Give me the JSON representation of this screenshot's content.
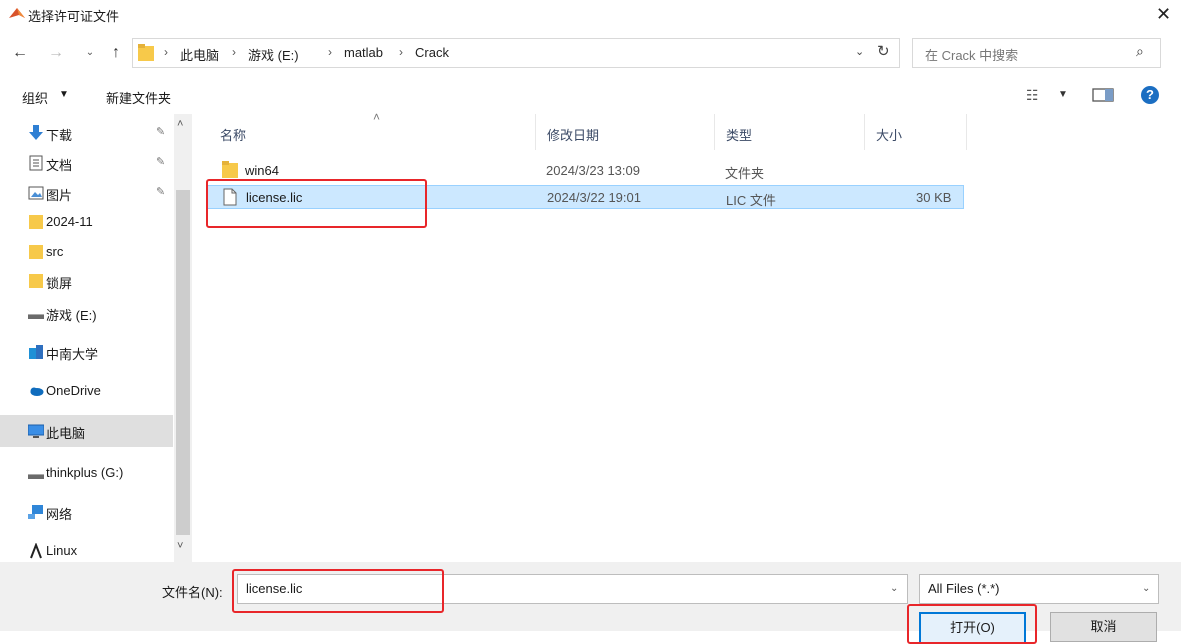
{
  "window": {
    "title": "选择许可证文件",
    "close_glyph": "✕",
    "app_icon": "matlab-icon"
  },
  "address_bar": {
    "back_glyph": "←",
    "forward_glyph": "→",
    "recent_glyph": "⌄",
    "up_glyph": "↑",
    "breadcrumbs": [
      "此电脑",
      "游戏 (E:)",
      "matlab",
      "Crack"
    ],
    "separator": "›",
    "dropdown_glyph": "⌄",
    "refresh_glyph": "↻"
  },
  "search": {
    "placeholder": "在 Crack 中搜索",
    "icon_glyph": "⌕"
  },
  "toolbar": {
    "organize_label": "组织",
    "caret": "▼",
    "new_folder_label": "新建文件夹",
    "view_glyph": "☷",
    "help_glyph": "?"
  },
  "nav": {
    "items": [
      {
        "label": "下载",
        "icon": "download-icon",
        "pinned": true
      },
      {
        "label": "文档",
        "icon": "documents-icon",
        "pinned": true
      },
      {
        "label": "图片",
        "icon": "pictures-icon",
        "pinned": true
      },
      {
        "label": "2024-11",
        "icon": "folder-icon",
        "pinned": false
      },
      {
        "label": "src",
        "icon": "folder-icon",
        "pinned": false
      },
      {
        "label": "锁屏",
        "icon": "folder-icon",
        "pinned": false
      },
      {
        "label": "游戏 (E:)",
        "icon": "drive-icon",
        "pinned": false
      },
      {
        "label": "中南大学",
        "icon": "organization-icon",
        "pinned": false
      },
      {
        "label": "OneDrive",
        "icon": "cloud-icon",
        "pinned": false
      },
      {
        "label": "此电脑",
        "icon": "computer-icon",
        "pinned": false
      },
      {
        "label": "thinkplus (G:)",
        "icon": "drive-icon",
        "pinned": false
      },
      {
        "label": "网络",
        "icon": "network-icon",
        "pinned": false
      },
      {
        "label": "Linux",
        "icon": "linux-icon",
        "pinned": false
      }
    ],
    "pin_glyph": "✎",
    "scroll_up_glyph": "˄",
    "scroll_down_glyph": "˅"
  },
  "file_list": {
    "sort_glyph": "˄",
    "columns": [
      "名称",
      "修改日期",
      "类型",
      "大小"
    ],
    "rows": [
      {
        "name": "win64",
        "modified": "2024/3/23 13:09",
        "type": "文件夹",
        "size": ""
      },
      {
        "name": "license.lic",
        "modified": "2024/3/22 19:01",
        "type": "LIC 文件",
        "size": "30 KB"
      }
    ]
  },
  "footer": {
    "filename_label": "文件名(N):",
    "filename_value": "license.lic",
    "dropdown_glyph": "⌄",
    "filter_value": "All Files (*.*)",
    "open_label": "打开(O)",
    "cancel_label": "取消"
  },
  "colors": {
    "selection": "#cce8ff",
    "annotation": "#e8262a",
    "folder": "#f7c94a",
    "accent": "#0078d7"
  }
}
